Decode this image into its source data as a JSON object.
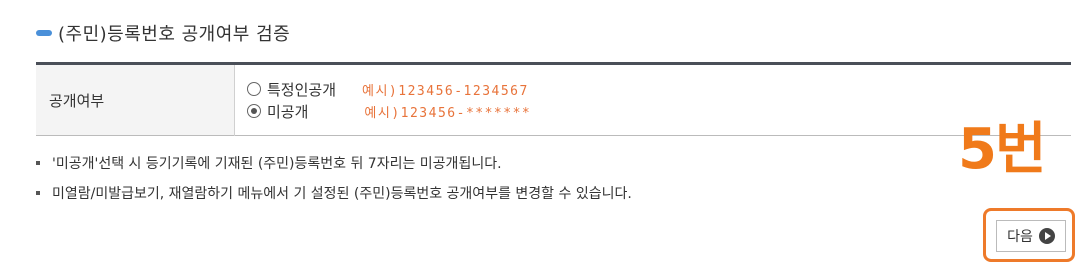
{
  "section": {
    "title": "(주민)등록번호 공개여부 검증"
  },
  "form": {
    "label": "공개여부",
    "options": [
      {
        "label": "특정인공개",
        "example": "예시)123456-1234567",
        "selected": false
      },
      {
        "label": "미공개",
        "example": "예시)123456-*******",
        "selected": true
      }
    ]
  },
  "notes": [
    "'미공개'선택 시 등기기록에 기재된 (주민)등록번호 뒤 7자리는 미공개됩니다.",
    "미열람/미발급보기, 재열람하기 메뉴에서 기 설정된 (주민)등록번호 공개여부를 변경할 수 있습니다."
  ],
  "annotation": {
    "label": "5번"
  },
  "next_button": {
    "label": "다음",
    "icon": "play-circle-icon"
  },
  "colors": {
    "accent": "#4a90d9",
    "highlight": "#ee7a2a",
    "example_text": "#e8733a"
  }
}
